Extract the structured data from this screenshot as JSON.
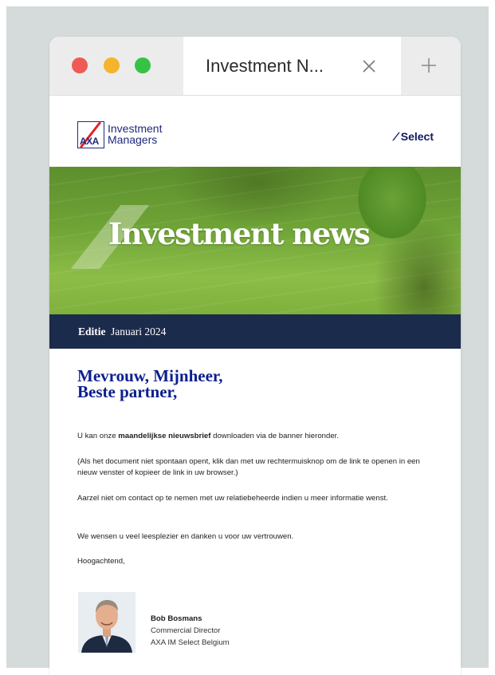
{
  "browser": {
    "tab_title": "Investment N...",
    "icons": [
      "close-icon",
      "plus-icon"
    ],
    "dot_colors": {
      "close": "#ee5b56",
      "minimize": "#f3b52c",
      "zoom": "#36c345"
    }
  },
  "email": {
    "logo": {
      "mark": "AXA",
      "line1": "Investment",
      "line2": "Managers"
    },
    "select_label": "Select",
    "banner_title": "Investment news",
    "edition_label": "Editie",
    "edition_date": "Januari 2024",
    "greeting_line1": "Mevrouw, Mijnheer,",
    "greeting_line2": "Beste partner,",
    "p1_before": "U kan onze ",
    "p1_bold": "maandelijkse nieuwsbrief",
    "p1_after": " downloaden via de banner hieronder.",
    "p2": "(Als het document niet spontaan opent, klik dan met uw rechtermuisknop om de link te openen in een nieuw venster of kopieer de link in uw browser.)",
    "p3": "Aarzel niet om contact op te nemen met uw relatiebeheerde indien u meer informatie wenst.",
    "p4": "We wensen u veel leesplezier en danken u voor uw vertrouwen.",
    "p5": "Hoogachtend,",
    "signature": {
      "name": "Bob Bosmans",
      "role": "Commercial Director",
      "company": "AXA IM Select Belgium"
    },
    "colors": {
      "navy": "#1b2b4c",
      "heading_blue": "#0c1f8f",
      "brand_blue": "#1f2a7a",
      "brand_red": "#e4202a"
    }
  }
}
